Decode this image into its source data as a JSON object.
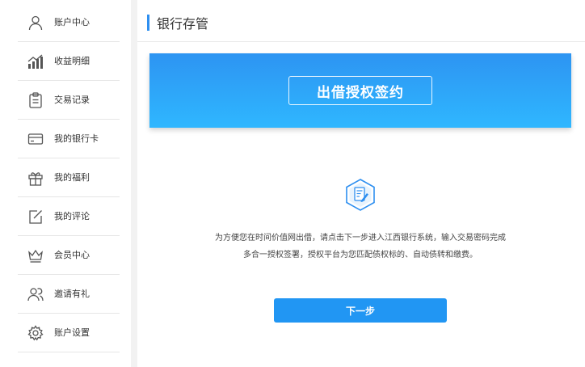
{
  "sidebar": {
    "items": [
      {
        "label": "账户中心",
        "icon": "user-icon"
      },
      {
        "label": "收益明细",
        "icon": "bar-chart-icon"
      },
      {
        "label": "交易记录",
        "icon": "clipboard-icon"
      },
      {
        "label": "我的银行卡",
        "icon": "card-icon"
      },
      {
        "label": "我的福利",
        "icon": "gift-icon"
      },
      {
        "label": "我的评论",
        "icon": "edit-icon"
      },
      {
        "label": "会员中心",
        "icon": "crown-icon"
      },
      {
        "label": "邀请有礼",
        "icon": "users-icon"
      },
      {
        "label": "账户设置",
        "icon": "gear-icon"
      }
    ]
  },
  "header": {
    "title": "银行存管"
  },
  "banner": {
    "label": "出借授权签约"
  },
  "content": {
    "icon": "document-sign-icon",
    "desc_line1": "为方便您在时间价值网出借，请点击下一步进入江西银行系统，输入交易密码完成",
    "desc_line2": "多合一授权签署，授权平台为您匹配债权标的、自动债转和缴费。",
    "next_label": "下一步"
  },
  "colors": {
    "accent": "#2196f3",
    "banner_top": "#2d94f2",
    "banner_bottom": "#2fb7ff"
  }
}
